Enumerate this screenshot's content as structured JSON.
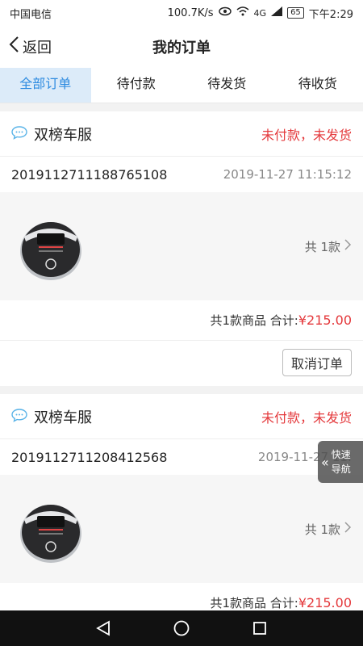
{
  "status_bar": {
    "carrier": "中国电信",
    "speed": "100.7K/s",
    "network": "4G",
    "battery": "65",
    "time": "下午2:29"
  },
  "header": {
    "back_label": "返回",
    "title": "我的订单"
  },
  "tabs": [
    {
      "label": "全部订单",
      "active": true
    },
    {
      "label": "待付款",
      "active": false
    },
    {
      "label": "待发货",
      "active": false
    },
    {
      "label": "待收货",
      "active": false
    }
  ],
  "orders": [
    {
      "shop_name": "双榜车服",
      "status": "未付款，未发货",
      "order_no": "2019112711188765108",
      "time": "2019-11-27 11:15:12",
      "item_count": "共 1款",
      "summary": "共1款商品 合计:",
      "total": "¥215.00",
      "action": "取消订单"
    },
    {
      "shop_name": "双榜车服",
      "status": "未付款，未发货",
      "order_no": "2019112711208412568",
      "time": "2019-11-27 11:",
      "item_count": "共 1款",
      "summary": "共1款商品 合计:",
      "total": "¥215.00"
    }
  ],
  "quick_nav": {
    "line1": "快速",
    "line2": "导航"
  },
  "colors": {
    "accent": "#2e8be0",
    "price": "#e4393c",
    "tab_active_bg": "#dcebf9"
  },
  "icons": {
    "chat": "chat-bubble-icon",
    "back": "chevron-left-icon",
    "more": "chevron-right-icon"
  }
}
